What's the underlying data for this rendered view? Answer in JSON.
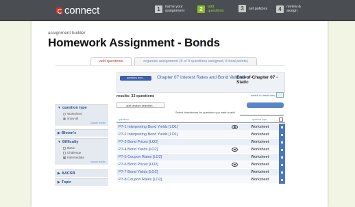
{
  "brand": {
    "name": "connect"
  },
  "steps": [
    {
      "num": "1",
      "label": "name your assignment",
      "active": false
    },
    {
      "num": "2",
      "label": "add questions",
      "active": true
    },
    {
      "num": "3",
      "label": "set policies",
      "active": false
    },
    {
      "num": "4",
      "label": "review & assign",
      "active": false
    }
  ],
  "header": {
    "crumb": "assignment builder",
    "title": "Homework Assignment - Bonds",
    "rename": "rename"
  },
  "tabs": [
    {
      "label": "add questions",
      "active": true
    },
    {
      "label": "organize assignment  (8 of 8 questions assigned, 8 total points)",
      "active": false
    }
  ],
  "chapter": {
    "button": "questions from...",
    "link": "Chapter 07 Interest Rates and Bond Valuation",
    "arrow": ">",
    "static": "End-of-Chapter 07 - Static"
  },
  "results": {
    "label": "results: 33 questions",
    "switch": "switch to detail view"
  },
  "add_random": "add random selection...",
  "select_note": "Select checkboxes for questions you want to add",
  "columns": {
    "question": "questions",
    "type": "question type"
  },
  "questions": [
    {
      "name": "P7-1 Interpreting Bond Yields [LO1]",
      "preview": true,
      "type": "Worksheet"
    },
    {
      "name": "P7-2 Interpreting Bond Yields [LO1]",
      "preview": false,
      "type": "Worksheet"
    },
    {
      "name": "P7-3 Bond Prices [LO2]",
      "preview": false,
      "type": "Worksheet"
    },
    {
      "name": "P7-4 Bond Yields [LO2]",
      "preview": true,
      "type": "Worksheet"
    },
    {
      "name": "P7-5 Coupon Rates [LO2]",
      "preview": false,
      "type": "Worksheet"
    },
    {
      "name": "P7-6 Bond Prices [LO2]",
      "preview": true,
      "type": "Worksheet"
    },
    {
      "name": "P7-7 Bond Yields [LO2]",
      "preview": false,
      "type": "Worksheet"
    },
    {
      "name": "P7-8 Coupon Rates [LO2]",
      "preview": false,
      "type": "Worksheet"
    }
  ],
  "sidebar": {
    "qtype": {
      "title": "question type",
      "options": [
        "Worksheet",
        "show all"
      ],
      "update": "update results"
    },
    "blooms": {
      "title": "Bloom's"
    },
    "difficulty": {
      "title": "Difficulty",
      "options": [
        "Basic",
        "Challenge",
        "Intermediate"
      ],
      "update": "update results"
    },
    "aacsb": {
      "title": "AACSB"
    },
    "topic": {
      "title": "Topic"
    }
  }
}
